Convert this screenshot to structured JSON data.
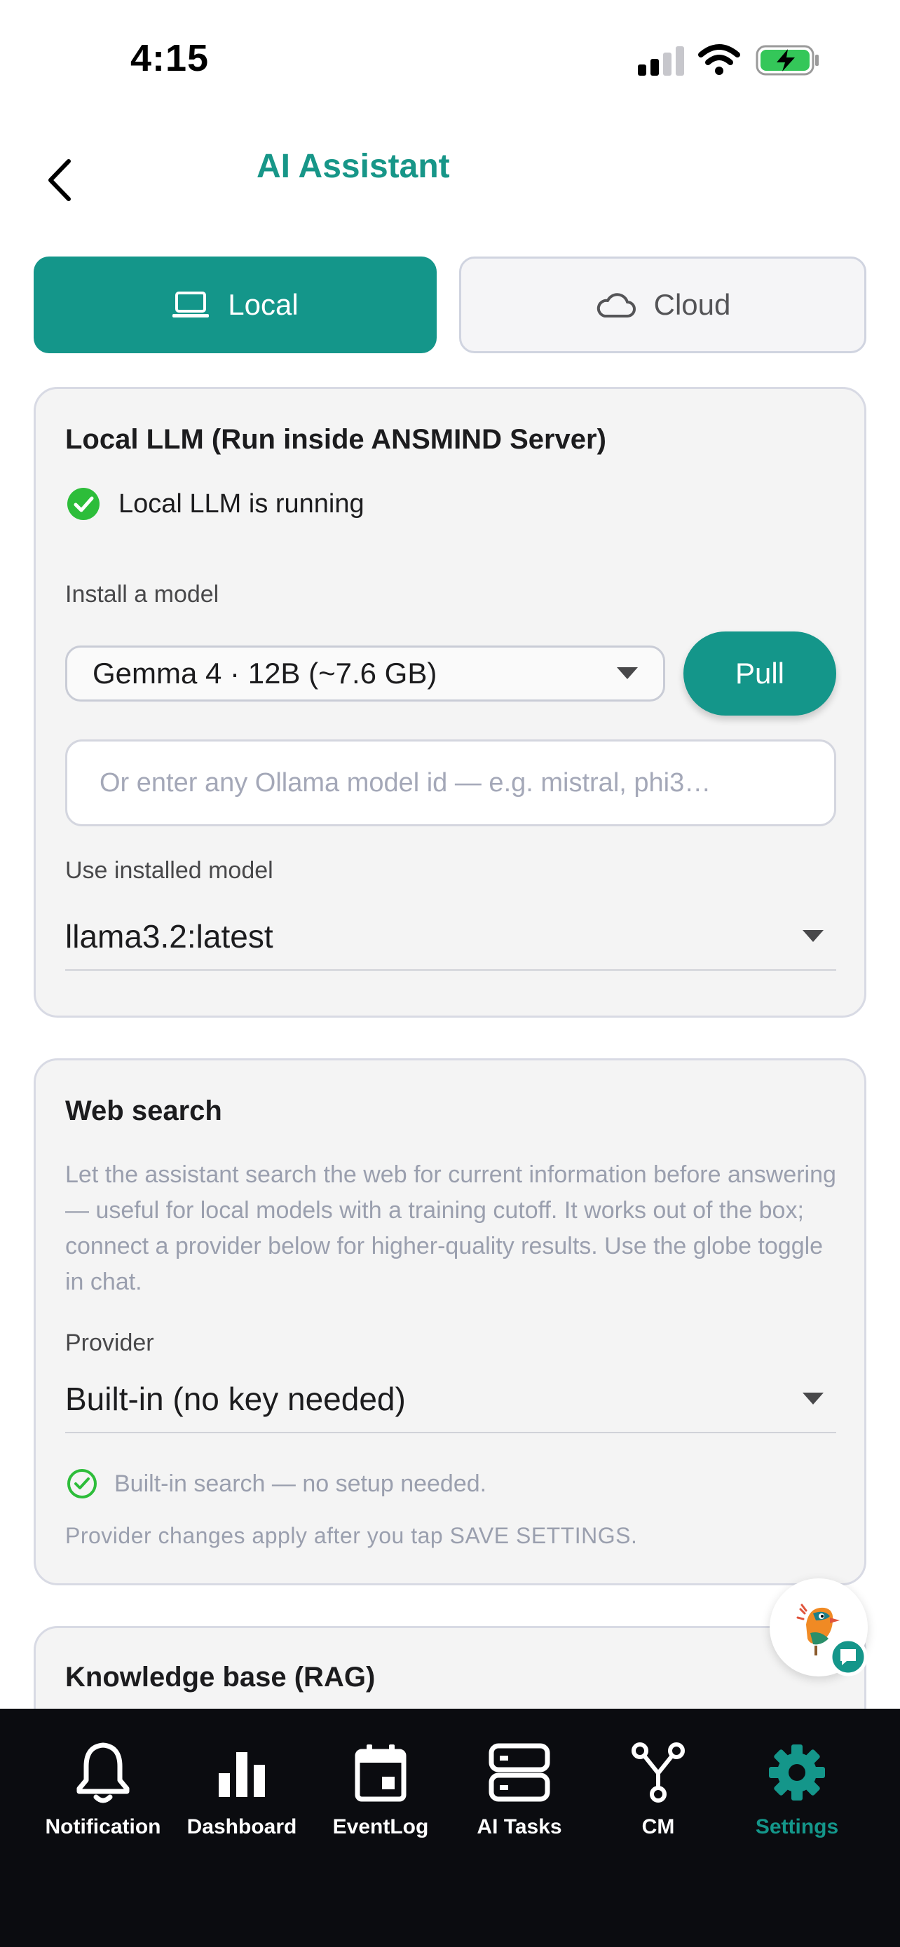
{
  "status_bar": {
    "time": "4:15"
  },
  "header": {
    "title": "AI Assistant"
  },
  "mode_toggle": {
    "local_label": "Local",
    "cloud_label": "Cloud",
    "selected": "Local"
  },
  "local_llm": {
    "title": "Local LLM (Run inside ANSMIND Server)",
    "status_text": "Local LLM is running",
    "install_label": "Install a model",
    "install_selected": "Gemma 4 · 12B (~7.6 GB)",
    "pull_label": "Pull",
    "model_id_placeholder": "Or enter any Ollama model id — e.g. mistral, phi3…",
    "model_id_value": "",
    "installed_label": "Use installed model",
    "installed_selected": "llama3.2:latest"
  },
  "web_search": {
    "title": "Web search",
    "description": "Let the assistant search the web for current information before answering — useful for local models with a training cutoff. It works out of the box; connect a provider below for higher-quality results. Use the globe toggle in chat.",
    "provider_label": "Provider",
    "provider_selected": "Built-in (no key needed)",
    "provider_status": "Built-in search — no setup needed.",
    "note": "Provider changes apply after you tap SAVE SETTINGS."
  },
  "knowledge_base": {
    "title": "Knowledge base (RAG)"
  },
  "bottom_nav": {
    "items": [
      {
        "label": "Notification",
        "icon": "bell-icon"
      },
      {
        "label": "Dashboard",
        "icon": "bar-chart-icon"
      },
      {
        "label": "EventLog",
        "icon": "calendar-icon"
      },
      {
        "label": "AI Tasks",
        "icon": "server-icon"
      },
      {
        "label": "CM",
        "icon": "graph-icon"
      },
      {
        "label": "Settings",
        "icon": "gear-icon"
      }
    ],
    "active": "Settings"
  },
  "colors": {
    "accent": "#14968a",
    "success": "#2dbd3a",
    "nav_bg": "#0b0c10",
    "card_bg": "#f4f4f4"
  }
}
